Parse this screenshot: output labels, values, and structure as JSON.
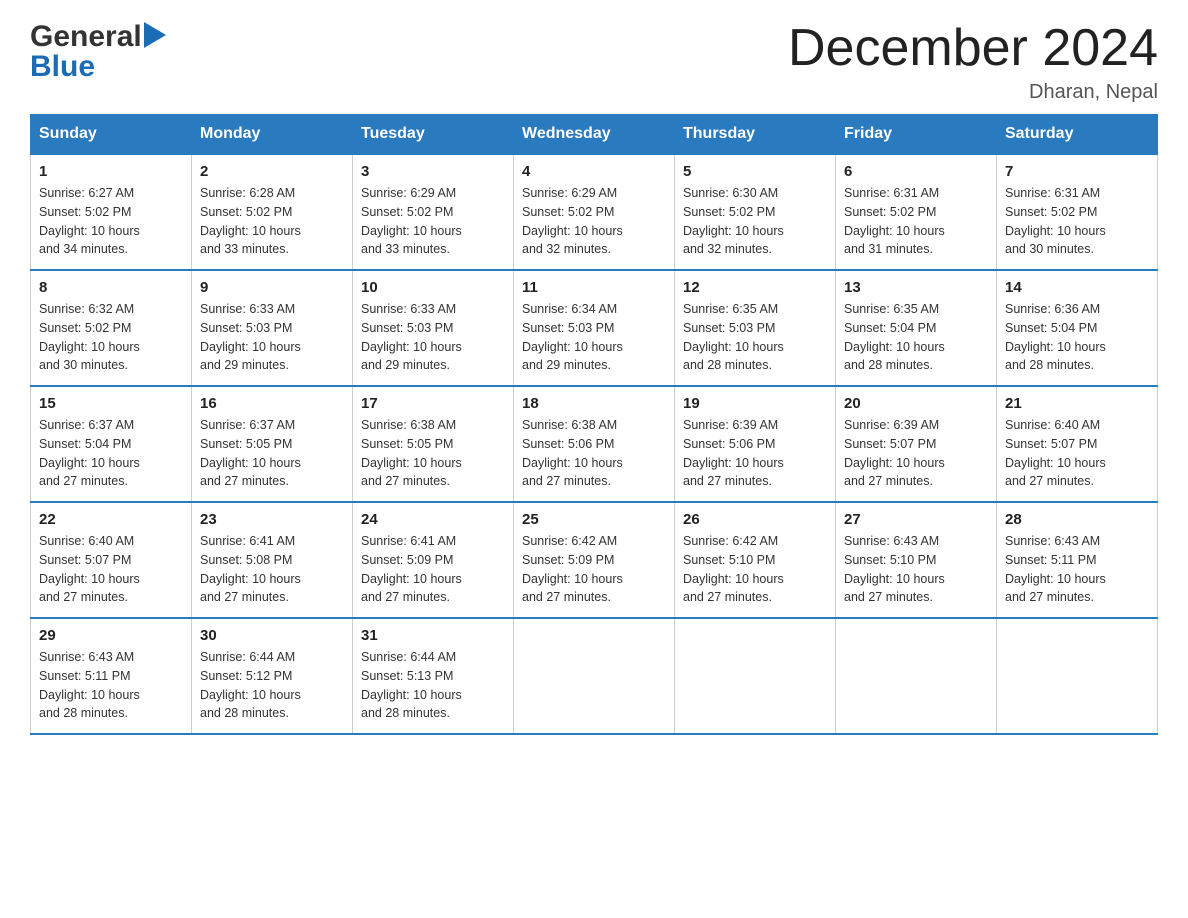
{
  "logo": {
    "general": "General",
    "blue": "Blue"
  },
  "header": {
    "title": "December 2024",
    "location": "Dharan, Nepal"
  },
  "days_of_week": [
    "Sunday",
    "Monday",
    "Tuesday",
    "Wednesday",
    "Thursday",
    "Friday",
    "Saturday"
  ],
  "weeks": [
    [
      {
        "day": "1",
        "sunrise": "6:27 AM",
        "sunset": "5:02 PM",
        "daylight": "10 hours and 34 minutes."
      },
      {
        "day": "2",
        "sunrise": "6:28 AM",
        "sunset": "5:02 PM",
        "daylight": "10 hours and 33 minutes."
      },
      {
        "day": "3",
        "sunrise": "6:29 AM",
        "sunset": "5:02 PM",
        "daylight": "10 hours and 33 minutes."
      },
      {
        "day": "4",
        "sunrise": "6:29 AM",
        "sunset": "5:02 PM",
        "daylight": "10 hours and 32 minutes."
      },
      {
        "day": "5",
        "sunrise": "6:30 AM",
        "sunset": "5:02 PM",
        "daylight": "10 hours and 32 minutes."
      },
      {
        "day": "6",
        "sunrise": "6:31 AM",
        "sunset": "5:02 PM",
        "daylight": "10 hours and 31 minutes."
      },
      {
        "day": "7",
        "sunrise": "6:31 AM",
        "sunset": "5:02 PM",
        "daylight": "10 hours and 30 minutes."
      }
    ],
    [
      {
        "day": "8",
        "sunrise": "6:32 AM",
        "sunset": "5:02 PM",
        "daylight": "10 hours and 30 minutes."
      },
      {
        "day": "9",
        "sunrise": "6:33 AM",
        "sunset": "5:03 PM",
        "daylight": "10 hours and 29 minutes."
      },
      {
        "day": "10",
        "sunrise": "6:33 AM",
        "sunset": "5:03 PM",
        "daylight": "10 hours and 29 minutes."
      },
      {
        "day": "11",
        "sunrise": "6:34 AM",
        "sunset": "5:03 PM",
        "daylight": "10 hours and 29 minutes."
      },
      {
        "day": "12",
        "sunrise": "6:35 AM",
        "sunset": "5:03 PM",
        "daylight": "10 hours and 28 minutes."
      },
      {
        "day": "13",
        "sunrise": "6:35 AM",
        "sunset": "5:04 PM",
        "daylight": "10 hours and 28 minutes."
      },
      {
        "day": "14",
        "sunrise": "6:36 AM",
        "sunset": "5:04 PM",
        "daylight": "10 hours and 28 minutes."
      }
    ],
    [
      {
        "day": "15",
        "sunrise": "6:37 AM",
        "sunset": "5:04 PM",
        "daylight": "10 hours and 27 minutes."
      },
      {
        "day": "16",
        "sunrise": "6:37 AM",
        "sunset": "5:05 PM",
        "daylight": "10 hours and 27 minutes."
      },
      {
        "day": "17",
        "sunrise": "6:38 AM",
        "sunset": "5:05 PM",
        "daylight": "10 hours and 27 minutes."
      },
      {
        "day": "18",
        "sunrise": "6:38 AM",
        "sunset": "5:06 PM",
        "daylight": "10 hours and 27 minutes."
      },
      {
        "day": "19",
        "sunrise": "6:39 AM",
        "sunset": "5:06 PM",
        "daylight": "10 hours and 27 minutes."
      },
      {
        "day": "20",
        "sunrise": "6:39 AM",
        "sunset": "5:07 PM",
        "daylight": "10 hours and 27 minutes."
      },
      {
        "day": "21",
        "sunrise": "6:40 AM",
        "sunset": "5:07 PM",
        "daylight": "10 hours and 27 minutes."
      }
    ],
    [
      {
        "day": "22",
        "sunrise": "6:40 AM",
        "sunset": "5:07 PM",
        "daylight": "10 hours and 27 minutes."
      },
      {
        "day": "23",
        "sunrise": "6:41 AM",
        "sunset": "5:08 PM",
        "daylight": "10 hours and 27 minutes."
      },
      {
        "day": "24",
        "sunrise": "6:41 AM",
        "sunset": "5:09 PM",
        "daylight": "10 hours and 27 minutes."
      },
      {
        "day": "25",
        "sunrise": "6:42 AM",
        "sunset": "5:09 PM",
        "daylight": "10 hours and 27 minutes."
      },
      {
        "day": "26",
        "sunrise": "6:42 AM",
        "sunset": "5:10 PM",
        "daylight": "10 hours and 27 minutes."
      },
      {
        "day": "27",
        "sunrise": "6:43 AM",
        "sunset": "5:10 PM",
        "daylight": "10 hours and 27 minutes."
      },
      {
        "day": "28",
        "sunrise": "6:43 AM",
        "sunset": "5:11 PM",
        "daylight": "10 hours and 27 minutes."
      }
    ],
    [
      {
        "day": "29",
        "sunrise": "6:43 AM",
        "sunset": "5:11 PM",
        "daylight": "10 hours and 28 minutes."
      },
      {
        "day": "30",
        "sunrise": "6:44 AM",
        "sunset": "5:12 PM",
        "daylight": "10 hours and 28 minutes."
      },
      {
        "day": "31",
        "sunrise": "6:44 AM",
        "sunset": "5:13 PM",
        "daylight": "10 hours and 28 minutes."
      },
      {
        "day": "",
        "sunrise": "",
        "sunset": "",
        "daylight": ""
      },
      {
        "day": "",
        "sunrise": "",
        "sunset": "",
        "daylight": ""
      },
      {
        "day": "",
        "sunrise": "",
        "sunset": "",
        "daylight": ""
      },
      {
        "day": "",
        "sunrise": "",
        "sunset": "",
        "daylight": ""
      }
    ]
  ],
  "labels": {
    "sunrise": "Sunrise: ",
    "sunset": "Sunset: ",
    "daylight": "Daylight: "
  }
}
